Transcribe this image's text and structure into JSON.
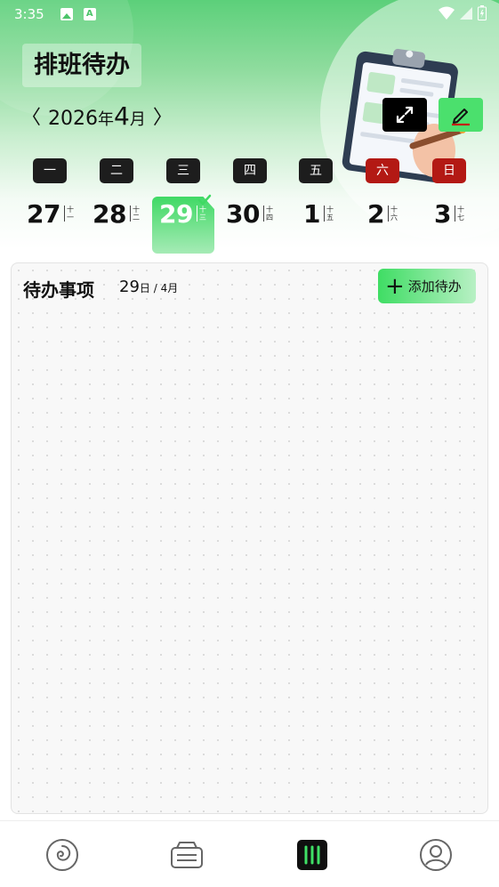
{
  "status_bar": {
    "time": "3:35"
  },
  "header": {
    "title": "排班待办",
    "year": "2026",
    "year_suffix": "年",
    "month_num": "4",
    "month_suffix": "月",
    "prev_arrow": "〈",
    "next_arrow": "〉"
  },
  "week": {
    "weekdays": [
      "一",
      "二",
      "三",
      "四",
      "五",
      "六",
      "日"
    ],
    "days": [
      {
        "num": "27",
        "lunar": [
          "十",
          "一"
        ]
      },
      {
        "num": "28",
        "lunar": [
          "十",
          "二"
        ]
      },
      {
        "num": "29",
        "lunar": [
          "十",
          "三"
        ]
      },
      {
        "num": "30",
        "lunar": [
          "十",
          "四"
        ]
      },
      {
        "num": "1",
        "lunar": [
          "十",
          "五"
        ]
      },
      {
        "num": "2",
        "lunar": [
          "十",
          "六"
        ]
      },
      {
        "num": "3",
        "lunar": [
          "十",
          "七"
        ]
      }
    ],
    "selected_index": 2
  },
  "todo": {
    "title": "待办事项",
    "day": "29",
    "day_suffix": "日",
    "month_part": " / 4月",
    "add_label": "添加待办"
  },
  "colors": {
    "accent_green": "#40d965",
    "weekend_red": "#b31914",
    "dark": "#1d1d1d"
  },
  "bottom_nav": {
    "items": [
      "swirl-icon",
      "ticket-icon",
      "calendar-bars-icon",
      "profile-icon"
    ],
    "active_index": 2
  }
}
